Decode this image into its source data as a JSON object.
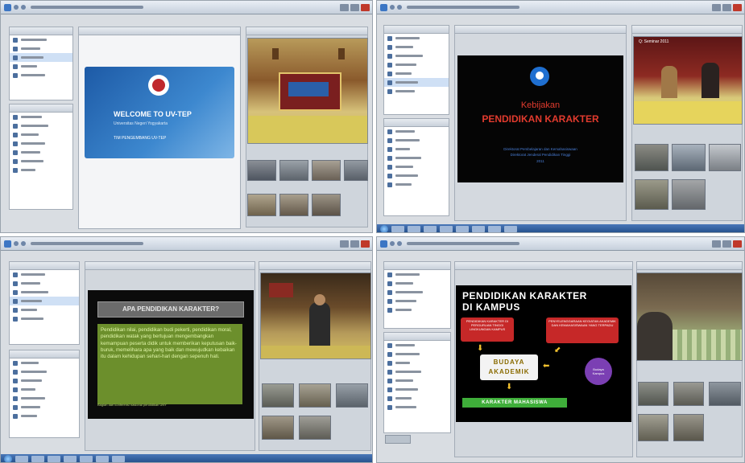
{
  "q1": {
    "slide_title": "WELCOME TO UV-TEP",
    "slide_subtitle": "Universitas Negeri Yogyakarta",
    "slide_footer": "TIM PENGEMBANG UV-TEP"
  },
  "q2": {
    "slide_pretitle": "Kebijakan",
    "slide_title": "PENDIDIKAN KARAKTER",
    "slide_sub1": "Direktorat Pembelajaran dan Kemahasiswaan",
    "slide_sub2": "Direktorat Jenderal Pendidikan Tinggi",
    "slide_sub3": "2011",
    "photo_caption": "Q: Seminar 2011"
  },
  "q3": {
    "slide_title": "APA PENDIDIKAN KARAKTER?",
    "slide_body": "Pendidikan nilai, pendidikan budi pekerti, pendidikan moral, pendidikan watak yang bertujuan mengembangkan kemampuan peserta didik untuk memberikan keputusan baik-buruk, memelihara apa yang baik dan mewujudkan kebaikan itu dalam kehidupan sehari-hari dengan sepenuh hati.",
    "slide_footnote": "Bagian dari konferensi nasional pendidikan UNY"
  },
  "q4": {
    "slide_title_1": "PENDIDIKAN KARAKTER",
    "slide_title_2": "DI KAMPUS",
    "box_left": "PENDIDIKAN KARAKTER DI PERGURUAN TINGGI LINGKUNGAN KAMPUS",
    "box_right": "PENYELENGGARAAN KEGIATAN AKADEMIK DAN KEMAHASISWAAN YANG TERPADU",
    "center_1": "BUDAYA",
    "center_2": "AKADEMIK",
    "circle": "Budaya Kampus",
    "bottom": "KARAKTER MAHASISWA"
  },
  "colors": {
    "q1_slide_blue": "#2f6fb4",
    "q2_title_red": "#e23b2e",
    "q3_text_green": "#dff5a8",
    "q4_red": "#c62828",
    "q4_purple": "#7b3fb3",
    "q4_green": "#3fae3a"
  }
}
